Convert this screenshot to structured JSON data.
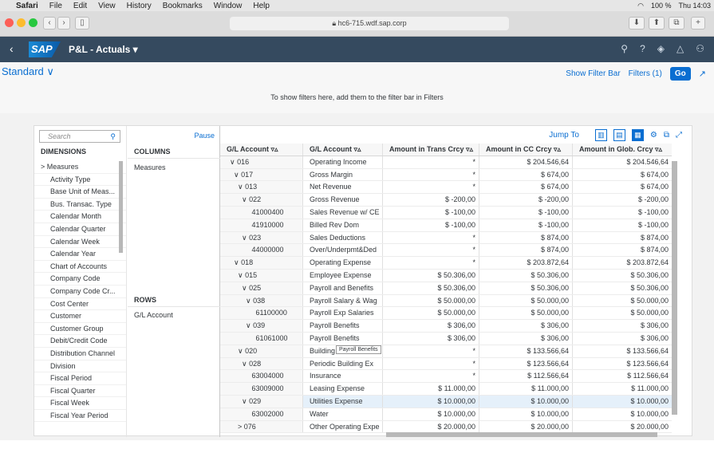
{
  "menubar": {
    "apple": "",
    "app": "Safari",
    "items": [
      "File",
      "Edit",
      "View",
      "History",
      "Bookmarks",
      "Window",
      "Help"
    ],
    "battery": "100 %",
    "clock": "Thu 14:03"
  },
  "browser": {
    "url": "hc6-715.wdf.sap.corp"
  },
  "shell": {
    "logo": "SAP",
    "title": "P&L - Actuals ▾"
  },
  "variant": {
    "name": "Standard ∨",
    "show_filter_bar": "Show Filter Bar",
    "filters": "Filters (1)",
    "go": "Go",
    "hint": "To show filters here, add them to the filter bar in Filters"
  },
  "panel": {
    "search_placeholder": "Search",
    "pause": "Pause",
    "dimensions_header": "DIMENSIONS",
    "columns_header": "COLUMNS",
    "rows_header": "ROWS",
    "column_items": [
      "Measures"
    ],
    "row_items": [
      "G/L Account"
    ],
    "dimensions": [
      "> Measures",
      "Activity Type",
      "Base Unit of Meas...",
      "Bus. Transac. Type",
      "Calendar Month",
      "Calendar Quarter",
      "Calendar Week",
      "Calendar Year",
      "Chart of Accounts",
      "Company Code",
      "Company Code Cr...",
      "Cost Center",
      "Customer",
      "Customer Group",
      "Debit/Credit Code",
      "Distribution Channel",
      "Division",
      "Fiscal Period",
      "Fiscal Quarter",
      "Fiscal Week",
      "Fiscal Year Period"
    ]
  },
  "grid": {
    "jump_to": "Jump To",
    "headers": [
      "G/L Account ▿▵",
      "G/L Account ▿▵",
      "Amount in Trans Crcy ▿▵",
      "Amount in CC Crcy ▿▵",
      "Amount in Glob. Crcy ▿▵"
    ],
    "tooltip": "Payroll Benefits",
    "rows": [
      [
        "∨ 016",
        "Operating Income",
        "*",
        "$ 204.546,64",
        "$ 204.546,64"
      ],
      [
        "  ∨ 017",
        "Gross Margin",
        "*",
        "$ 674,00",
        "$ 674,00"
      ],
      [
        "    ∨ 013",
        "Net Revenue",
        "*",
        "$ 674,00",
        "$ 674,00"
      ],
      [
        "      ∨ 022",
        "Gross Revenue",
        "$ -200,00",
        "$ -200,00",
        "$ -200,00"
      ],
      [
        "           41000400",
        "Sales Revenue w/ CE",
        "$ -100,00",
        "$ -100,00",
        "$ -100,00"
      ],
      [
        "           41910000",
        "Billed Rev Dom",
        "$ -100,00",
        "$ -100,00",
        "$ -100,00"
      ],
      [
        "      ∨ 023",
        "Sales Deductions",
        "*",
        "$ 874,00",
        "$ 874,00"
      ],
      [
        "           44000000",
        "Over/Underpmt&Ded",
        "*",
        "$ 874,00",
        "$ 874,00"
      ],
      [
        "  ∨ 018",
        "Operating Expense",
        "*",
        "$ 203.872,64",
        "$ 203.872,64"
      ],
      [
        "    ∨ 015",
        "Employee Expense",
        "$ 50.306,00",
        "$ 50.306,00",
        "$ 50.306,00"
      ],
      [
        "      ∨ 025",
        "Payroll and Benefits",
        "$ 50.306,00",
        "$ 50.306,00",
        "$ 50.306,00"
      ],
      [
        "        ∨ 038",
        "Payroll Salary & Wag",
        "$ 50.000,00",
        "$ 50.000,00",
        "$ 50.000,00"
      ],
      [
        "             61100000",
        "Payroll Exp Salaries",
        "$ 50.000,00",
        "$ 50.000,00",
        "$ 50.000,00"
      ],
      [
        "        ∨ 039",
        "Payroll Benefits",
        "$ 306,00",
        "$ 306,00",
        "$ 306,00"
      ],
      [
        "             61061000",
        "Payroll Benefits",
        "$ 306,00",
        "$ 306,00",
        "$ 306,00"
      ],
      [
        "    ∨ 020",
        "Building",
        "*",
        "$ 133.566,64",
        "$ 133.566,64"
      ],
      [
        "      ∨ 028",
        "Periodic Building Ex",
        "*",
        "$ 123.566,64",
        "$ 123.566,64"
      ],
      [
        "           63004000",
        "Insurance",
        "*",
        "$ 112.566,64",
        "$ 112.566,64"
      ],
      [
        "           63009000",
        "Leasing Expense",
        "$ 11.000,00",
        "$ 11.000,00",
        "$ 11.000,00"
      ],
      [
        "      ∨ 029",
        "Utilities Expense",
        "$ 10.000,00",
        "$ 10.000,00",
        "$ 10.000,00"
      ],
      [
        "           63002000",
        "Water",
        "$ 10.000,00",
        "$ 10.000,00",
        "$ 10.000,00"
      ],
      [
        "    > 076",
        "Other Operating Expe",
        "$ 20.000,00",
        "$ 20.000,00",
        "$ 20.000,00"
      ]
    ]
  }
}
